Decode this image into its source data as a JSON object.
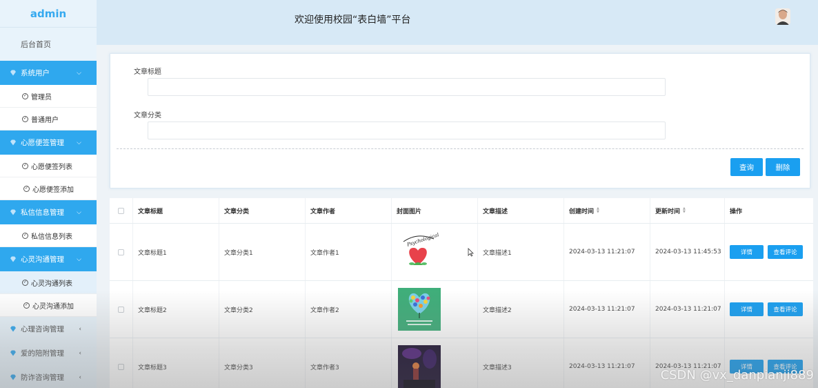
{
  "sidebar": {
    "brand": "admin",
    "home": "后台首页",
    "groups": [
      {
        "label": "系统用户",
        "items": [
          "管理员",
          "普通用户"
        ]
      },
      {
        "label": "心愿便签管理",
        "items": [
          "心愿便签列表",
          "心愿便签添加"
        ]
      },
      {
        "label": "私信信息管理",
        "items": [
          "私信信息列表"
        ]
      },
      {
        "label": "心灵沟通管理",
        "items": [
          "心灵沟通列表",
          "心灵沟通添加"
        ]
      },
      {
        "label": "心理咨询管理",
        "items": []
      },
      {
        "label": "爱的陪附管理",
        "items": []
      },
      {
        "label": "防诈咨询管理",
        "items": []
      }
    ]
  },
  "header": {
    "title": "欢迎使用校园“表白墙”平台"
  },
  "search": {
    "field1_label": "文章标题",
    "field1_value": "",
    "field2_label": "文章分类",
    "field2_value": "",
    "query_button": "查询",
    "delete_button": "删除"
  },
  "table": {
    "columns": [
      "文章标题",
      "文章分类",
      "文章作者",
      "封面图片",
      "文章描述",
      "创建时间",
      "更新时间",
      "操作"
    ],
    "rows": [
      {
        "title": "文章标题1",
        "category": "文章分类1",
        "author": "文章作者1",
        "image": "heart-logo",
        "desc": "文章描述1",
        "created": "2024-03-13 11:21:07",
        "updated": "2024-03-13 11:45:53"
      },
      {
        "title": "文章标题2",
        "category": "文章分类2",
        "author": "文章作者2",
        "image": "green-heart-tree",
        "desc": "文章描述2",
        "created": "2024-03-13 11:21:07",
        "updated": "2024-03-13 11:21:07"
      },
      {
        "title": "文章标题3",
        "category": "文章分类3",
        "author": "文章作者3",
        "image": "dark-concert",
        "desc": "文章描述3",
        "created": "2024-03-13 11:21:07",
        "updated": "2024-03-13 11:21:07"
      }
    ],
    "detail_button": "详情",
    "comment_button": "查看评论"
  },
  "watermark": "CSDN @vx_danpianji889",
  "colors": {
    "accent": "#1a9ff0",
    "sidebar_group": "#2fa8ee",
    "header_bg": "#d7e9f6"
  }
}
